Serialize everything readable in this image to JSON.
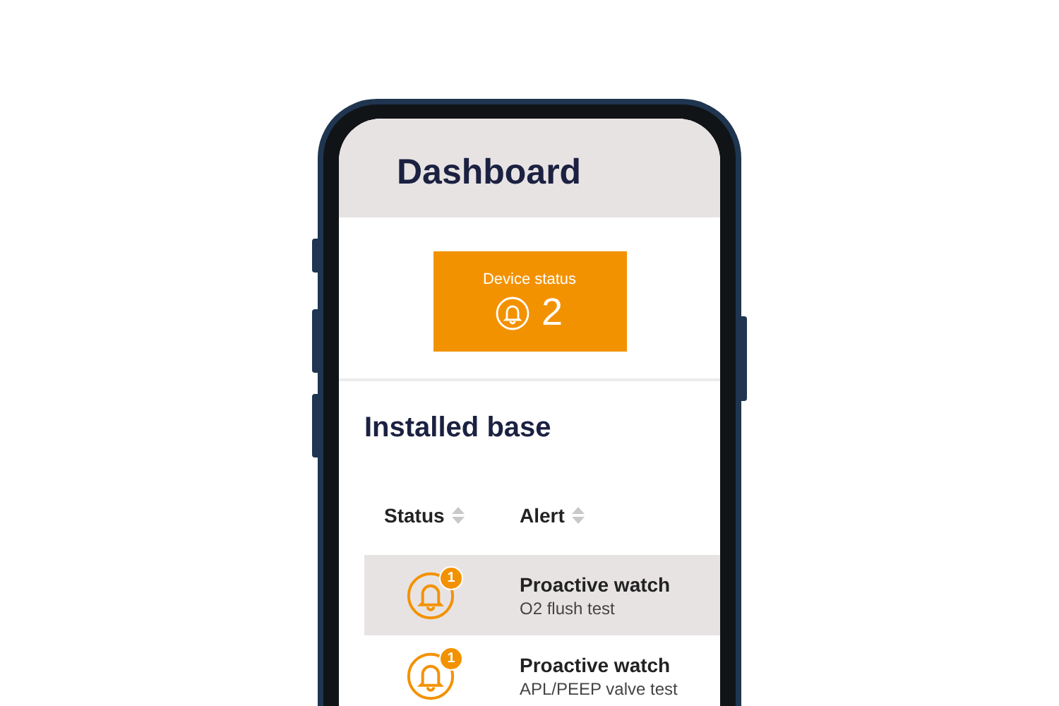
{
  "header": {
    "title": "Dashboard"
  },
  "device_status": {
    "label": "Device status",
    "count": "2"
  },
  "installed_base": {
    "title": "Installed base",
    "columns": [
      "Status",
      "Alert"
    ],
    "rows": [
      {
        "badge": "1",
        "alert": "Proactive watch",
        "detail": "O2 flush test",
        "selected": true
      },
      {
        "badge": "1",
        "alert": "Proactive watch",
        "detail": "APL/PEEP valve test",
        "selected": false
      }
    ]
  }
}
